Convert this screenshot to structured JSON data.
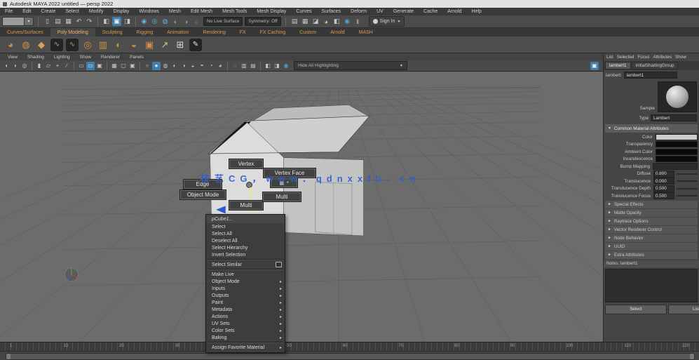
{
  "window": {
    "title": "Autodesk MAYA 2022 untitled  —  persp 2022"
  },
  "colors": {
    "accent_blue": "#3f7fae",
    "snap_teal": "#62b6d8",
    "shelf_text": "#d79b52",
    "watermark_blue": "#2e5ed0",
    "yellow_guide": "#e6e57a"
  },
  "menu_bar": {
    "items": [
      "File",
      "Edit",
      "Create",
      "Select",
      "Modify",
      "Display",
      "Windows",
      "Mesh",
      "Edit Mesh",
      "Mesh Tools",
      "Mesh Display",
      "Curves",
      "Surfaces",
      "Deform",
      "UV",
      "Generate",
      "Cache",
      "Arnold",
      "Help"
    ]
  },
  "status_line": {
    "icons_left": [
      {
        "n": "new-scene-icon",
        "g": "▯"
      },
      {
        "n": "open-scene-icon",
        "g": "▤"
      },
      {
        "n": "save-scene-icon",
        "g": "▦"
      },
      {
        "n": "undo-icon",
        "g": "↶"
      },
      {
        "n": "redo-icon",
        "g": "↷"
      },
      {
        "sep": true
      },
      {
        "n": "select-by-hierarchy-icon",
        "g": "◧"
      },
      {
        "n": "select-by-object-icon",
        "g": "▣",
        "active": true
      },
      {
        "n": "select-by-component-icon",
        "g": "◨"
      },
      {
        "sep": true
      },
      {
        "n": "snap-to-grid-icon",
        "g": "◉",
        "teal": true
      },
      {
        "n": "snap-to-curve-icon",
        "g": "◎",
        "teal": true
      },
      {
        "n": "snap-to-point-icon",
        "g": "◍",
        "teal": true
      },
      {
        "n": "snap-to-projected-center-icon",
        "g": "◐",
        "teal": true
      },
      {
        "n": "snap-to-view-plane-icon",
        "g": "◑",
        "teal": true
      },
      {
        "n": "make-object-live-icon",
        "g": "○",
        "teal": true
      }
    ],
    "field_live": "No Live Surface",
    "field_symmetry": "Symmetry: Off",
    "icons_right": [
      {
        "n": "render-view-icon",
        "g": "▤"
      },
      {
        "n": "render-current-frame-icon",
        "g": "▦"
      },
      {
        "n": "ipr-render-icon",
        "g": "◪"
      },
      {
        "n": "render-settings-icon",
        "g": "◕"
      },
      {
        "n": "light-editor-icon",
        "g": "◧"
      },
      {
        "n": "arnold-renderview-icon",
        "g": "◉",
        "blue": true
      },
      {
        "n": "pause-icon",
        "g": "‖"
      }
    ],
    "account_label": "Sign In"
  },
  "shelf": {
    "tabs": [
      "Curves/Surfaces",
      "Poly Modeling",
      "Sculpting",
      "Rigging",
      "Animation",
      "Rendering",
      "FX",
      "FX Caching",
      "Custom",
      "Arnold",
      "MASH"
    ],
    "active_tab": "Poly Modeling",
    "icons": [
      {
        "n": "poly-sphere-icon",
        "g": "◕",
        "c": "#cf8f45"
      },
      {
        "n": "poly-cube-icon",
        "g": "◍",
        "c": "#cf8f45"
      },
      {
        "n": "poly-plane-icon",
        "g": "◆",
        "c": "#d8a05a"
      },
      {
        "n": "ep-curve-tool-icon",
        "g": "∿",
        "c": "#7fb3d0",
        "chip": true
      },
      {
        "n": "bezier-curve-tool-icon",
        "g": "∿",
        "c": "#c9955a",
        "chip": true
      },
      {
        "n": "poly-torus-icon",
        "g": "◎",
        "c": "#cf8f45"
      },
      {
        "n": "poly-cylinder-icon",
        "g": "▥",
        "c": "#cf8f45"
      },
      {
        "n": "poly-disc-icon",
        "g": "◐",
        "c": "#cf8f45"
      },
      {
        "n": "poly-gear-icon",
        "g": "◒",
        "c": "#cf8f45"
      },
      {
        "n": "poly-platonic-icon",
        "g": "▣",
        "c": "#cf8f45"
      },
      {
        "n": "measure-tool-icon",
        "g": "↗",
        "c": "#d8c08a"
      },
      {
        "n": "quad-draw-icon",
        "g": "⊞",
        "c": "#dadada"
      },
      {
        "n": "multi-cut-icon",
        "g": "✎",
        "c": "#e8e8e8",
        "chip": true
      }
    ]
  },
  "viewport": {
    "menu": [
      "View",
      "Shading",
      "Lighting",
      "Show",
      "Renderer",
      "Panels"
    ],
    "toolbar_icons": [
      {
        "n": "select-camera-icon",
        "g": "◖"
      },
      {
        "n": "lock-camera-icon",
        "g": "◗"
      },
      {
        "n": "camera-attributes-icon",
        "g": "◎"
      },
      {
        "sep": true
      },
      {
        "n": "bookmark-icon",
        "g": "▮"
      },
      {
        "n": "image-plane-icon",
        "g": "▱"
      },
      {
        "n": "2d-pan-zoom-icon",
        "g": "+"
      },
      {
        "n": "grease-pencil-icon",
        "g": "∕"
      },
      {
        "sep": true
      },
      {
        "n": "film-gate-icon",
        "g": "▭"
      },
      {
        "n": "resolution-gate-icon",
        "g": "▭",
        "active": true
      },
      {
        "n": "gate-mask-icon",
        "g": "▣"
      },
      {
        "sep": true
      },
      {
        "n": "field-chart-icon",
        "g": "▦"
      },
      {
        "n": "safe-action-icon",
        "g": "▢"
      },
      {
        "n": "safe-title-icon",
        "g": "▣"
      },
      {
        "sep": true
      },
      {
        "n": "wireframe-icon",
        "g": "○"
      },
      {
        "n": "shaded-icon",
        "g": "●",
        "active": true
      },
      {
        "n": "textured-icon",
        "g": "◍"
      },
      {
        "n": "use-all-lights-icon",
        "g": "◐"
      },
      {
        "n": "shadows-icon",
        "g": "◑"
      },
      {
        "n": "screen-space-ao-icon",
        "g": "◒"
      },
      {
        "n": "motion-blur-icon",
        "g": "◓"
      },
      {
        "n": "multisample-anti-aliasing-icon",
        "g": "◔"
      },
      {
        "n": "depth-of-field-icon",
        "g": "◕"
      },
      {
        "sep": true
      },
      {
        "n": "isolate-select-icon",
        "g": "◌"
      },
      {
        "n": "xray-icon",
        "g": "▥"
      },
      {
        "n": "joints-xray-icon",
        "g": "▤"
      },
      {
        "sep": true
      },
      {
        "n": "exposure-icon",
        "g": "◧"
      },
      {
        "n": "gamma-icon",
        "g": "◨"
      },
      {
        "n": "view-transform-icon",
        "g": "◉",
        "blue": true
      }
    ],
    "dropdown_label": "Hide All Highlighting",
    "hud_icon": {
      "n": "heads-up-display-icon",
      "g": "▣"
    },
    "watermark": "技艺CG，www．qdnxxfb．cn"
  },
  "marking_menu": {
    "items": [
      {
        "label": "Vertex",
        "pos": "n"
      },
      {
        "label": "Vertex Face",
        "pos": "ne"
      },
      {
        "label": "Edge",
        "pos": "w"
      },
      {
        "label": "Object Mode",
        "pos": "sw"
      },
      {
        "label": "Multi",
        "pos": "s"
      },
      {
        "label": "Multi",
        "pos": "se"
      }
    ],
    "center_glyphs": [
      "▦",
      "•"
    ]
  },
  "context_menu": {
    "header": "pCube1...",
    "items": [
      {
        "label": "Select"
      },
      {
        "label": "Select All"
      },
      {
        "label": "Deselect All"
      },
      {
        "label": "Select Hierarchy"
      },
      {
        "label": "Invert Selection"
      },
      {
        "sep": true
      },
      {
        "label": "Select Similar",
        "optbox": true
      },
      {
        "sep": true
      },
      {
        "label": "Make Live"
      },
      {
        "label": "Object Mode",
        "arrow": true
      },
      {
        "label": "Inputs",
        "arrow": true
      },
      {
        "label": "Outputs",
        "arrow": true
      },
      {
        "label": "Paint",
        "arrow": true
      },
      {
        "label": "Metadata",
        "arrow": true
      },
      {
        "label": "Actions",
        "arrow": true
      },
      {
        "label": "UV Sets",
        "arrow": true
      },
      {
        "label": "Color Sets",
        "arrow": true
      },
      {
        "label": "Baking",
        "arrow": true
      },
      {
        "sep": true
      },
      {
        "label": "Assign Favorite Material",
        "arrow": true
      }
    ]
  },
  "attribute_editor": {
    "menu": [
      "List",
      "Selected",
      "Focus",
      "Attributes",
      "Show"
    ],
    "tabs": [
      "lambert1",
      "initialShadingGroup"
    ],
    "active_tab": "lambert1",
    "node_type_label": "lambert:",
    "node_name": "lambert1",
    "sample_label": "Sample",
    "type_label": "Type",
    "type_value": "Lambert",
    "common_section_title": "Common Material Attributes",
    "common_rows": [
      {
        "label": "Color",
        "kind": "color",
        "swatch": "#cdcdcd"
      },
      {
        "label": "Transparency",
        "kind": "color",
        "swatch": "#0a0a0a"
      },
      {
        "label": "Ambient Color",
        "kind": "color",
        "swatch": "#0a0a0a"
      },
      {
        "label": "Incandescence",
        "kind": "color",
        "swatch": "#0a0a0a"
      },
      {
        "label": "Bump Mapping",
        "kind": "field",
        "value": ""
      },
      {
        "label": "Diffuse",
        "kind": "value",
        "value": "0.800"
      },
      {
        "label": "Translucence",
        "kind": "value",
        "value": "0.000"
      },
      {
        "label": "Translucence Depth",
        "kind": "value",
        "value": "0.500"
      },
      {
        "label": "Translucence Focus",
        "kind": "value",
        "value": "0.500"
      }
    ],
    "collapsed_sections": [
      "Special Effects",
      "Matte Opacity",
      "Raytrace Options",
      "Vector Renderer Control",
      "Node Behavior",
      "UUID",
      "Extra Attributes"
    ],
    "notes_label": "Notes: lambert1",
    "buttons": [
      "Select",
      "Load Attributes"
    ]
  },
  "timeline": {
    "labels": [
      "1",
      "10",
      "20",
      "30",
      "40",
      "50",
      "60",
      "70",
      "80",
      "90",
      "100",
      "110",
      "120"
    ]
  }
}
